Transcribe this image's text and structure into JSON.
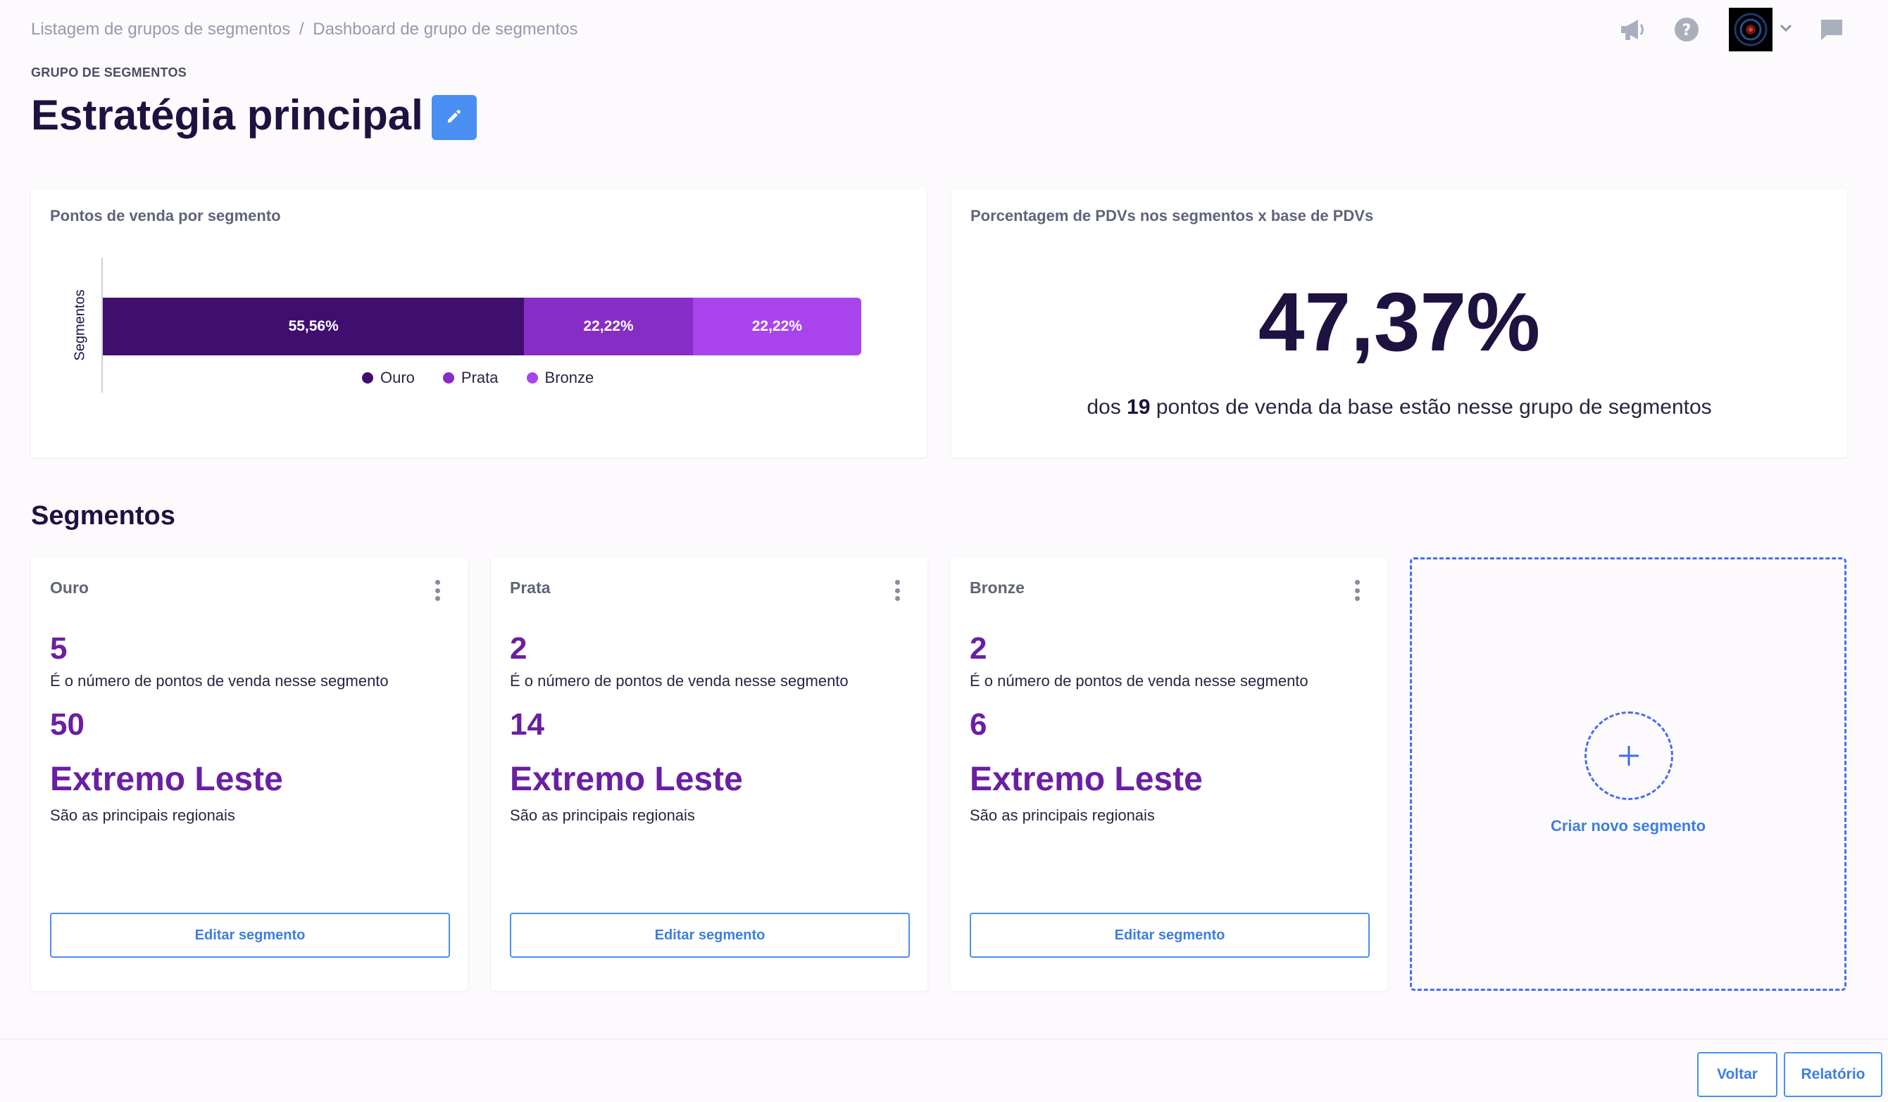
{
  "breadcrumb": {
    "parent": "Listagem de grupos de segmentos",
    "separator": "/",
    "current": "Dashboard de grupo de segmentos"
  },
  "header": {
    "eyebrow": "GRUPO DE SEGMENTOS",
    "title": "Estratégia principal"
  },
  "distribution_card": {
    "title": "Pontos de venda por segmento",
    "chart_data": {
      "type": "bar",
      "orientation": "horizontal-stacked",
      "ylabel": "Segmentos",
      "series": [
        {
          "name": "Ouro",
          "value": 55.56,
          "label": "55,56%",
          "color": "#3f0e6e"
        },
        {
          "name": "Prata",
          "value": 22.22,
          "label": "22,22%",
          "color": "#862dc5"
        },
        {
          "name": "Bronze",
          "value": 22.22,
          "label": "22,22%",
          "color": "#a944ed"
        }
      ],
      "legend_position": "bottom"
    }
  },
  "percentage_card": {
    "title": "Porcentagem de PDVs nos segmentos x base de PDVs",
    "value": "47,37%",
    "desc_prefix": "dos",
    "desc_total": "19",
    "desc_suffix": "pontos de venda da base estão nesse grupo de segmentos"
  },
  "segments_section": {
    "title": "Segmentos",
    "count_desc": "É o número de pontos de venda nesse segmento",
    "region_desc": "São as principais regionais",
    "edit_label": "Editar segmento",
    "items": [
      {
        "name": "Ouro",
        "count": "5",
        "second_value": "50",
        "region": "Extremo Leste"
      },
      {
        "name": "Prata",
        "count": "2",
        "second_value": "14",
        "region": "Extremo Leste"
      },
      {
        "name": "Bronze",
        "count": "2",
        "second_value": "6",
        "region": "Extremo Leste"
      }
    ],
    "new_segment_label": "Criar novo segmento"
  },
  "footer": {
    "back_label": "Voltar",
    "report_label": "Relatório"
  },
  "colors": {
    "accent": "#4a8ff2",
    "segment_value": "#6a1fa3",
    "title": "#1e1240"
  },
  "icons": [
    "megaphone-icon",
    "help-icon",
    "chevron-down-icon",
    "chat-icon",
    "pencil-icon",
    "kebab-icon",
    "plus-icon"
  ]
}
